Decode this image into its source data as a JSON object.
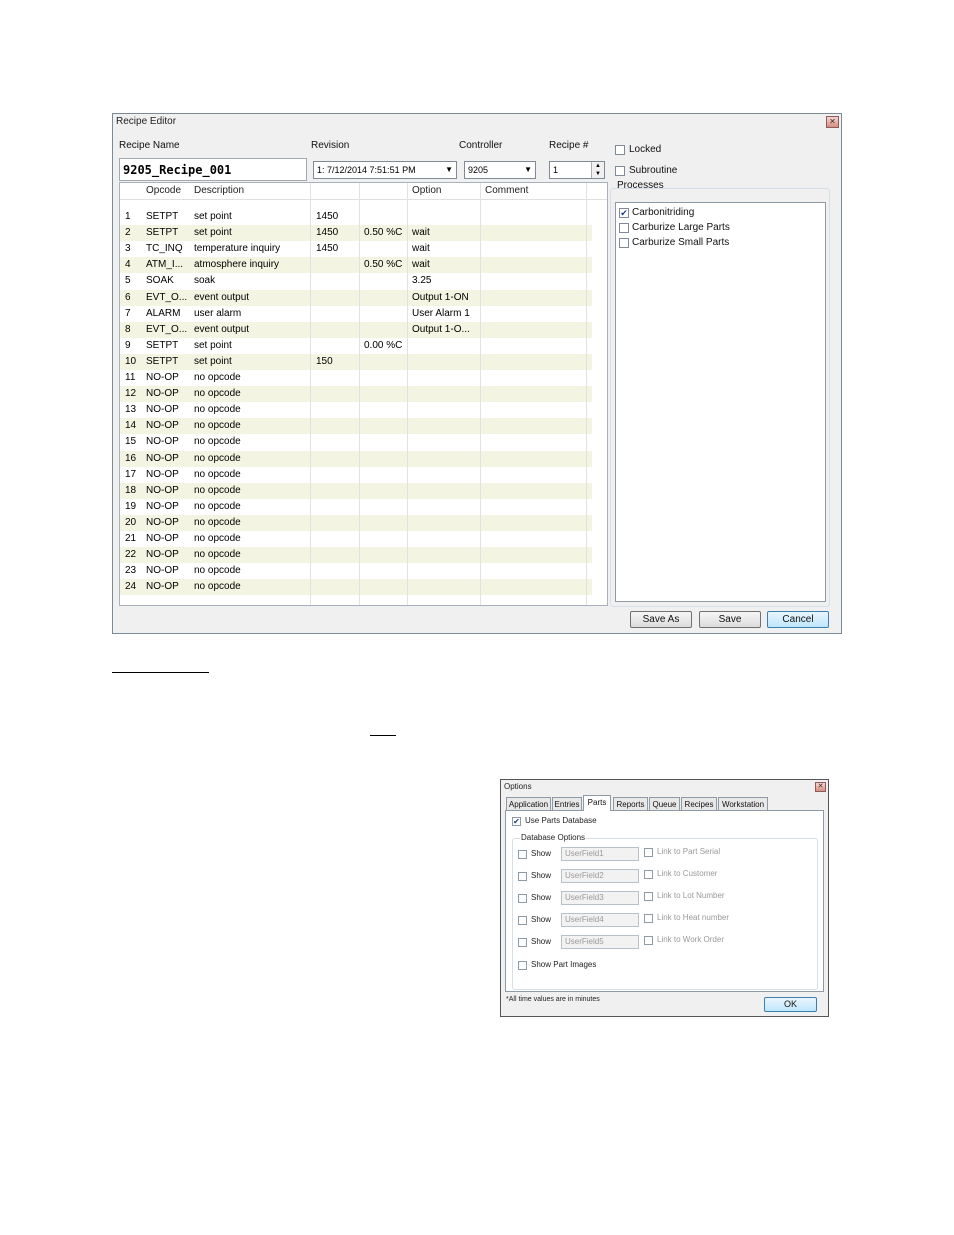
{
  "recipe_editor": {
    "title": "Recipe Editor",
    "recipe_name_label": "Recipe Name",
    "recipe_name_value": "9205_Recipe_001",
    "revision_label": "Revision",
    "revision_value": "1: 7/12/2014 7:51:51 PM",
    "controller_label": "Controller",
    "controller_value": "9205",
    "recipe_num_label": "Recipe #",
    "recipe_num_value": "1",
    "locked_label": "Locked",
    "subroutine_label": "Subroutine",
    "processes_label": "Processes",
    "processes": [
      {
        "label": "Carbonitriding",
        "checked": true
      },
      {
        "label": "Carburize Large Parts",
        "checked": false
      },
      {
        "label": "Carburize Small Parts",
        "checked": false
      }
    ],
    "columns": [
      "Opcode",
      "Description",
      "",
      "",
      "Option",
      "Comment"
    ],
    "rows": [
      {
        "num": "1",
        "opcode": "SETPT",
        "desc": "set point",
        "v1": "1450",
        "v2": "",
        "option": "",
        "comment": ""
      },
      {
        "num": "2",
        "opcode": "SETPT",
        "desc": "set point",
        "v1": "1450",
        "v2": "0.50 %C",
        "option": "wait",
        "comment": ""
      },
      {
        "num": "3",
        "opcode": "TC_INQ",
        "desc": "temperature inquiry",
        "v1": "1450",
        "v2": "",
        "option": "wait",
        "comment": ""
      },
      {
        "num": "4",
        "opcode": "ATM_I...",
        "desc": "atmosphere inquiry",
        "v1": "",
        "v2": "0.50 %C",
        "option": "wait",
        "comment": ""
      },
      {
        "num": "5",
        "opcode": "SOAK",
        "desc": "soak",
        "v1": "",
        "v2": "",
        "option": "3.25",
        "comment": ""
      },
      {
        "num": "6",
        "opcode": "EVT_O...",
        "desc": "event output",
        "v1": "",
        "v2": "",
        "option": "Output 1-ON",
        "comment": ""
      },
      {
        "num": "7",
        "opcode": "ALARM",
        "desc": "user alarm",
        "v1": "",
        "v2": "",
        "option": "User Alarm 1",
        "comment": ""
      },
      {
        "num": "8",
        "opcode": "EVT_O...",
        "desc": "event output",
        "v1": "",
        "v2": "",
        "option": "Output 1-O...",
        "comment": ""
      },
      {
        "num": "9",
        "opcode": "SETPT",
        "desc": "set point",
        "v1": "",
        "v2": "0.00 %C",
        "option": "",
        "comment": ""
      },
      {
        "num": "10",
        "opcode": "SETPT",
        "desc": "set point",
        "v1": "150",
        "v2": "",
        "option": "",
        "comment": ""
      },
      {
        "num": "11",
        "opcode": "NO-OP",
        "desc": "no opcode",
        "v1": "",
        "v2": "",
        "option": "",
        "comment": ""
      },
      {
        "num": "12",
        "opcode": "NO-OP",
        "desc": "no opcode",
        "v1": "",
        "v2": "",
        "option": "",
        "comment": ""
      },
      {
        "num": "13",
        "opcode": "NO-OP",
        "desc": "no opcode",
        "v1": "",
        "v2": "",
        "option": "",
        "comment": ""
      },
      {
        "num": "14",
        "opcode": "NO-OP",
        "desc": "no opcode",
        "v1": "",
        "v2": "",
        "option": "",
        "comment": ""
      },
      {
        "num": "15",
        "opcode": "NO-OP",
        "desc": "no opcode",
        "v1": "",
        "v2": "",
        "option": "",
        "comment": ""
      },
      {
        "num": "16",
        "opcode": "NO-OP",
        "desc": "no opcode",
        "v1": "",
        "v2": "",
        "option": "",
        "comment": ""
      },
      {
        "num": "17",
        "opcode": "NO-OP",
        "desc": "no opcode",
        "v1": "",
        "v2": "",
        "option": "",
        "comment": ""
      },
      {
        "num": "18",
        "opcode": "NO-OP",
        "desc": "no opcode",
        "v1": "",
        "v2": "",
        "option": "",
        "comment": ""
      },
      {
        "num": "19",
        "opcode": "NO-OP",
        "desc": "no opcode",
        "v1": "",
        "v2": "",
        "option": "",
        "comment": ""
      },
      {
        "num": "20",
        "opcode": "NO-OP",
        "desc": "no opcode",
        "v1": "",
        "v2": "",
        "option": "",
        "comment": ""
      },
      {
        "num": "21",
        "opcode": "NO-OP",
        "desc": "no opcode",
        "v1": "",
        "v2": "",
        "option": "",
        "comment": ""
      },
      {
        "num": "22",
        "opcode": "NO-OP",
        "desc": "no opcode",
        "v1": "",
        "v2": "",
        "option": "",
        "comment": ""
      },
      {
        "num": "23",
        "opcode": "NO-OP",
        "desc": "no opcode",
        "v1": "",
        "v2": "",
        "option": "",
        "comment": ""
      },
      {
        "num": "24",
        "opcode": "NO-OP",
        "desc": "no opcode",
        "v1": "",
        "v2": "",
        "option": "",
        "comment": ""
      }
    ],
    "buttons": {
      "save_as": "Save As",
      "save": "Save",
      "cancel": "Cancel"
    }
  },
  "options_dialog": {
    "title": "Options",
    "tabs": [
      "Application",
      "Entries",
      "Parts",
      "Reports",
      "Queue",
      "Recipes",
      "Workstation"
    ],
    "active_tab": "Parts",
    "use_parts_db_label": "Use Parts Database",
    "use_parts_db_checked": true,
    "db_options_label": "Database Options",
    "fields": [
      {
        "show": "Show",
        "value": "UserField1",
        "link": "Link to Part Serial"
      },
      {
        "show": "Show",
        "value": "UserField2",
        "link": "Link to Customer"
      },
      {
        "show": "Show",
        "value": "UserField3",
        "link": "Link to Lot Number"
      },
      {
        "show": "Show",
        "value": "UserField4",
        "link": "Link to Heat number"
      },
      {
        "show": "Show",
        "value": "UserField5",
        "link": "Link to Work Order"
      }
    ],
    "show_part_images_label": "Show Part Images",
    "footnote": "*All time values are in minutes",
    "ok_label": "OK"
  },
  "icons": {
    "close": "close-icon",
    "dropdown": "chevron-down-icon",
    "spinner": "spinner-arrows-icon",
    "check": "checkmark-icon"
  }
}
